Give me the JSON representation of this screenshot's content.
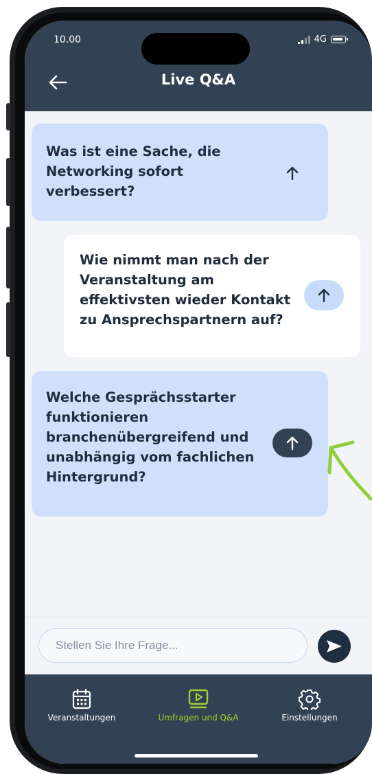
{
  "status": {
    "time": "10.00",
    "network": "4G"
  },
  "header": {
    "title": "Live Q&A"
  },
  "questions": [
    {
      "text": "Was ist eine Sache, die Networking sofort verbessert?",
      "voted": false
    },
    {
      "text": "Wie nimmt man nach der Veranstaltung am effektivsten wieder Kontakt zu Ansprechspartnern auf?",
      "voted": false
    },
    {
      "text": "Welche Gesprächsstarter funktionieren branchenübergreifend und unabhängig vom fachlichen Hintergrund?",
      "voted": true
    }
  ],
  "input": {
    "placeholder": "Stellen Sie Ihre Frage..."
  },
  "tabs": [
    {
      "label": "Veranstaltungen",
      "icon": "calendar-icon",
      "active": false
    },
    {
      "label": "Umfragen und Q&A",
      "icon": "play-screen-icon",
      "active": true
    },
    {
      "label": "Einstellungen",
      "icon": "gear-icon",
      "active": false
    }
  ],
  "colors": {
    "header_bg": "#324153",
    "card_blue": "#cfe0fb",
    "card_white": "#ffffff",
    "vote_light": "#c7dcfb",
    "vote_dark": "#324153",
    "active_tab": "#a4d12e",
    "annotation_green": "#8fcf3e"
  }
}
